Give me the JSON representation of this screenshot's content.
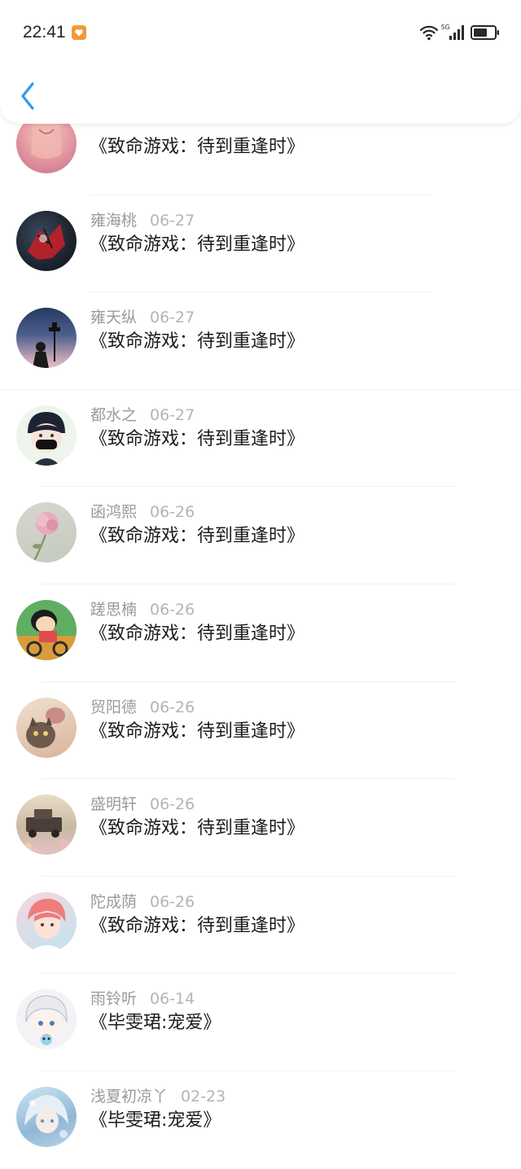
{
  "status_bar": {
    "time": "22:41",
    "network": "5G"
  },
  "nav": {
    "back_icon": "chevron-left-icon"
  },
  "comments": [
    {
      "name": "",
      "date": "",
      "text": "《致命游戏：待到重逢时》",
      "avatar": "pink-figure"
    },
    {
      "name": "雍海桃",
      "date": "06-27",
      "text": "《致命游戏：待到重逢时》",
      "avatar": "spider-man"
    },
    {
      "name": "雍天纵",
      "date": "06-27",
      "text": "《致命游戏：待到重逢时》",
      "avatar": "night-street"
    },
    {
      "name": "都水之",
      "date": "06-27",
      "text": "《致命游戏：待到重逢时》",
      "avatar": "masked-boy"
    },
    {
      "name": "函鸿熙",
      "date": "06-26",
      "text": "《致命游戏：待到重逢时》",
      "avatar": "pink-flower"
    },
    {
      "name": "蹉思楠",
      "date": "06-26",
      "text": "《致命游戏：待到重逢时》",
      "avatar": "cartoon-kid"
    },
    {
      "name": "贸阳德",
      "date": "06-26",
      "text": "《致命游戏：待到重逢时》",
      "avatar": "cat"
    },
    {
      "name": "盛明轩",
      "date": "06-26",
      "text": "《致命游戏：待到重逢时》",
      "avatar": "truck"
    },
    {
      "name": "陀成荫",
      "date": "06-26",
      "text": "《致命游戏：待到重逢时》",
      "avatar": "red-hair-boy"
    },
    {
      "name": "雨铃听",
      "date": "06-14",
      "text": "《毕雯珺:宠爱》",
      "avatar": "white-hair-anime"
    },
    {
      "name": "浅夏初凉丫",
      "date": "02-23",
      "text": "《毕雯珺:宠爱》",
      "avatar": "blue-anime-girl"
    }
  ],
  "colors": {
    "back_arrow": "#2f9bea",
    "name_text": "#9a9a9a",
    "date_text": "#b4b4b4",
    "content_text": "#1c1c1c",
    "badge": "#f2993a"
  }
}
